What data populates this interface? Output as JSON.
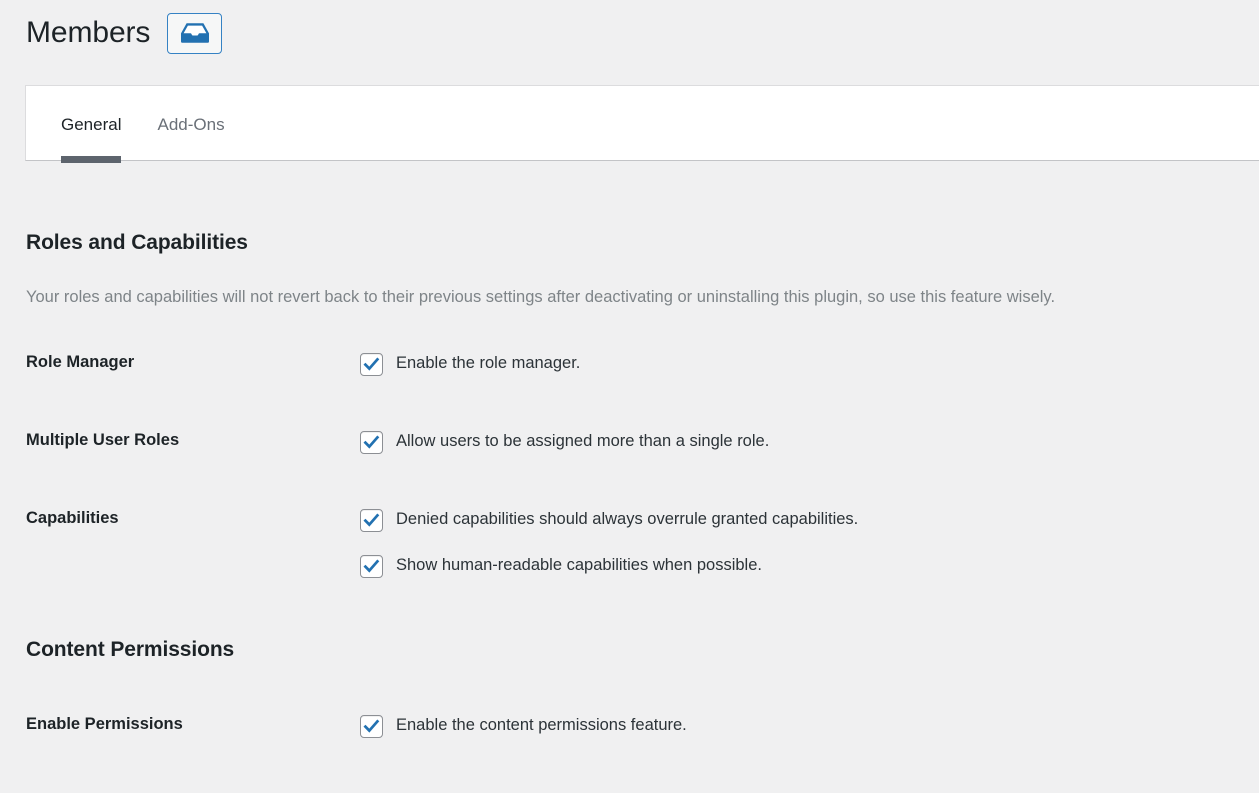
{
  "header": {
    "title": "Members",
    "icon_button": {
      "name": "members-inbox-icon",
      "icon": "inbox-tray-icon",
      "color": "#2271b1"
    }
  },
  "tabs": [
    {
      "label": "General",
      "active": true
    },
    {
      "label": "Add-Ons",
      "active": false
    }
  ],
  "sections": [
    {
      "heading": "Roles and Capabilities",
      "description": "Your roles and capabilities will not revert back to their previous settings after deactivating or uninstalling this plugin, so use this feature wisely.",
      "fields": [
        {
          "label": "Role Manager",
          "options": [
            {
              "label": "Enable the role manager.",
              "checked": true
            }
          ]
        },
        {
          "label": "Multiple User Roles",
          "options": [
            {
              "label": "Allow users to be assigned more than a single role.",
              "checked": true
            }
          ]
        },
        {
          "label": "Capabilities",
          "options": [
            {
              "label": "Denied capabilities should always overrule granted capabilities.",
              "checked": true
            },
            {
              "label": "Show human-readable capabilities when possible.",
              "checked": true
            }
          ]
        }
      ]
    },
    {
      "heading": "Content Permissions",
      "description": "",
      "fields": [
        {
          "label": "Enable Permissions",
          "options": [
            {
              "label": "Enable the content permissions feature.",
              "checked": true
            }
          ]
        }
      ]
    }
  ],
  "colors": {
    "page_background": "#f0f0f1",
    "panel_background": "#ffffff",
    "accent_blue": "#2271b1",
    "active_tab_underline": "#5d646d",
    "muted_text": "#7e8488",
    "checkbox_check": "#2271b1"
  }
}
